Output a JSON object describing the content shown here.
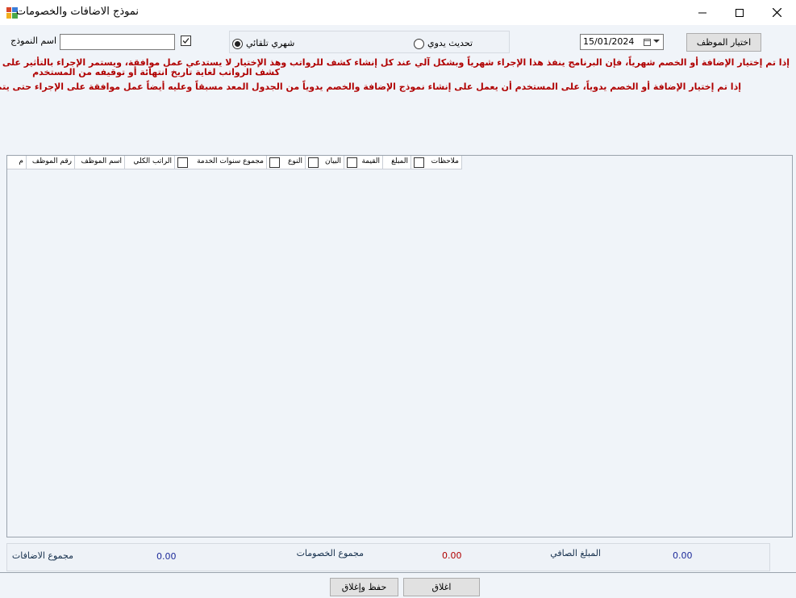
{
  "window": {
    "title": "نموذج الاضافات والخصومات",
    "icon": "form-app-icon",
    "controls": [
      "minimize-icon",
      "maximize-icon",
      "close-icon"
    ]
  },
  "form": {
    "name_label": "اسم النموذج",
    "name_value": "",
    "top_checkbox_checked": true,
    "radio_auto_label": "شهري تلقائي",
    "radio_manual_label": "تحديث يدوي",
    "selected_mode": "auto",
    "date_value": "15/01/2024",
    "select_employee_label": "اختيار الموظف"
  },
  "notes": {
    "line1": "إذا تم إختيار الإضافة أو الخصم شهرياً، فإن البرنامج ينفذ هذا الإجراء شهرياً وبشكل آلي عند كل إنشاء كشف للرواتب وهذ الإختيار لا يستدعي عمل موافقة، ويستمر الإجراء بالتأثير على",
    "line1b": "كشف الرواتب لغاية تاريخ انتهائة أو توقيفه من المستخدم",
    "line2": "إذا تم إختيار الإضافة أو الخصم يدوياً، على المستخدم أن يعمل على إنشاء نموذج الإضافة والخصم يدوياً من الجدول المعد مسبقاً وعليه أيضاً عمل موافقة على الإجراء حتى يتم التأثير"
  },
  "grid": {
    "columns": [
      {
        "label": "ملاحظات",
        "checkbox": true
      },
      {
        "label": "المبلغ",
        "checkbox": false
      },
      {
        "label": "القيمة",
        "checkbox": true
      },
      {
        "label": "البيان",
        "checkbox": true
      },
      {
        "label": "النوع",
        "checkbox": true
      },
      {
        "label": "مجموع سنوات الخدمة",
        "checkbox": true
      },
      {
        "label": "الراتب الكلي",
        "checkbox": false
      },
      {
        "label": "اسم الموظف",
        "checkbox": false
      },
      {
        "label": "رقم الموظف",
        "checkbox": false
      },
      {
        "label": "م",
        "checkbox": false
      }
    ],
    "rows": []
  },
  "totals": {
    "additions_label": "مجموع الاضافات",
    "additions_value": "0.00",
    "deductions_label": "مجموع الخصومات",
    "deductions_value": "0.00",
    "net_label": "المبلغ الصافي",
    "net_value": "0.00"
  },
  "buttons": {
    "save_close": "حفظ وإغلاق",
    "close": "اغلاق"
  },
  "colors": {
    "note_red": "#b00000",
    "value_blue": "#1d2b9a",
    "background": "#f0f4f9"
  }
}
